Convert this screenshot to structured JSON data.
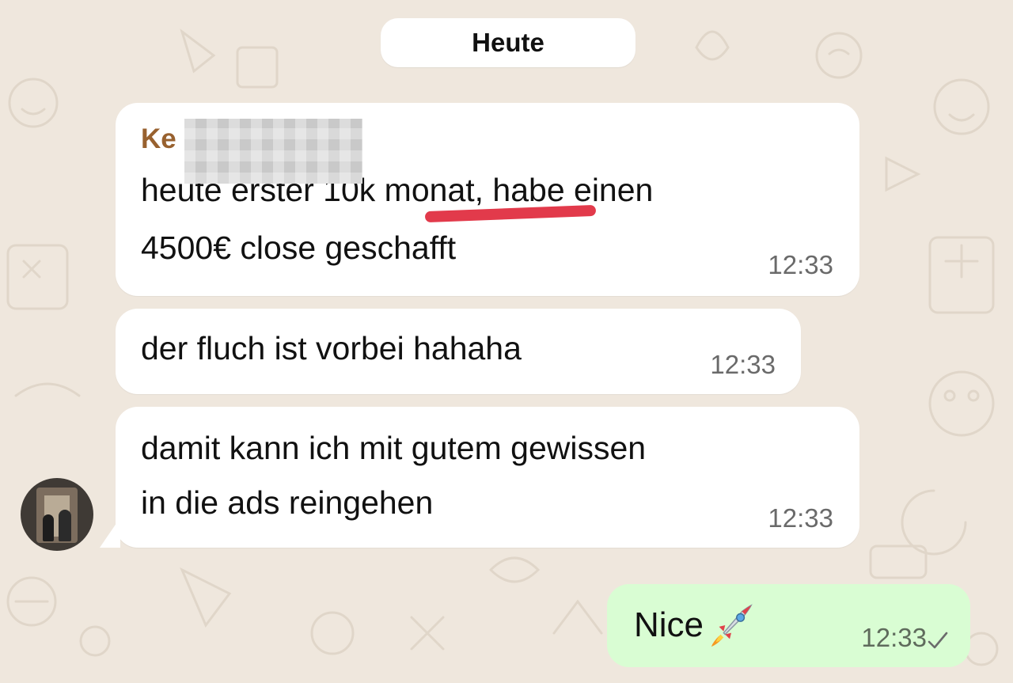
{
  "date_separator": "Heute",
  "messages": [
    {
      "direction": "incoming",
      "sender": "Ke",
      "lines": [
        "heute erster 10k monat, habe einen",
        "4500€ close geschafft"
      ],
      "time": "12:33"
    },
    {
      "direction": "incoming",
      "lines": [
        "der fluch ist vorbei hahaha"
      ],
      "time": "12:33"
    },
    {
      "direction": "incoming",
      "lines": [
        "damit kann ich mit gutem gewissen",
        "in die ads reingehen"
      ],
      "time": "12:33"
    },
    {
      "direction": "outgoing",
      "text": "Nice",
      "emoji": "rocket-icon",
      "time": "12:33",
      "status": "sent-check-icon"
    }
  ],
  "colors": {
    "background": "#efe7dd",
    "incoming_bubble": "#ffffff",
    "outgoing_bubble": "#d9fdd3",
    "sender_name": "#98612f",
    "highlight_underline": "#e23a4b"
  }
}
